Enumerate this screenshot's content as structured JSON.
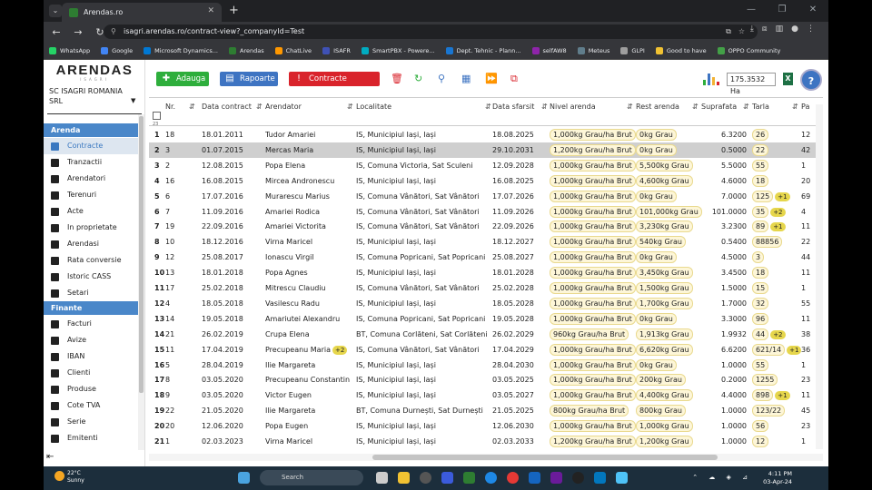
{
  "browser": {
    "tab_title": "Arendas.ro",
    "url": "isagri.arendas.ro/contract-view?_companyId=Test",
    "bookmarks": [
      "WhatsApp",
      "Google",
      "Microsoft Dynamics...",
      "Arendas",
      "ChatLive",
      "ISAFR",
      "SmartPBX - Powere...",
      "Dept. Tehnic - Plann...",
      "selfAW8",
      "Meteus",
      "GLPI",
      "Good to have",
      "OPPO Community"
    ]
  },
  "sidebar": {
    "logo": "ARENDAS",
    "logo_sub": "ISAGRI",
    "company": "SC ISAGRI ROMANIA SRL",
    "sections": [
      {
        "title": "Arenda",
        "items": [
          "Contracte",
          "Tranzactii",
          "Arendatori",
          "Terenuri",
          "Acte",
          "In proprietate",
          "Arendasi",
          "Rata conversie",
          "Istoric CASS",
          "Setari"
        ]
      },
      {
        "title": "Finante",
        "items": [
          "Facturi",
          "Avize",
          "IBAN",
          "Clienti",
          "Produse",
          "Cote TVA",
          "Serie",
          "Emitenti"
        ]
      }
    ],
    "active_item": "Contracte"
  },
  "toolbar": {
    "add_label": "Adauga",
    "reports_label": "Rapoarte",
    "expired_label": "Contracte expirate",
    "surface_total": "175.3532 Ha"
  },
  "table": {
    "row_count_label": "23",
    "columns": [
      "Nr.",
      "Data contract",
      "Arendator",
      "Localitate",
      "Data sfarsit",
      "Nivel arenda",
      "Rest arenda",
      "Suprafata",
      "Tarla",
      "Pa"
    ],
    "rows": [
      {
        "idx": "1",
        "nr": "18",
        "date": "18.01.2011",
        "arendator": "Tudor Amariei",
        "arendator_badge": "",
        "loc": "IS, Municipiul Iași, Iași",
        "end": "18.08.2025",
        "nivel": "1,000kg Grau/ha Brut",
        "rest": "0kg Grau",
        "supr": "6.3200",
        "tarla": "26",
        "tarla_badge": "",
        "pa": "12"
      },
      {
        "idx": "2",
        "nr": "3",
        "date": "01.07.2015",
        "arendator": "Mercas Maria",
        "arendator_badge": "",
        "loc": "IS, Municipiul Iași, Iași",
        "end": "29.10.2031",
        "nivel": "1,200kg Grau/ha Brut",
        "rest": "0kg Grau",
        "supr": "0.5000",
        "tarla": "22",
        "tarla_badge": "",
        "pa": "42"
      },
      {
        "idx": "3",
        "nr": "2",
        "date": "12.08.2015",
        "arendator": "Popa Elena",
        "arendator_badge": "",
        "loc": "IS, Comuna Victoria, Sat Sculeni",
        "end": "12.09.2028",
        "nivel": "1,000kg Grau/ha Brut",
        "rest": "5,500kg Grau",
        "supr": "5.5000",
        "tarla": "55",
        "tarla_badge": "",
        "pa": "1"
      },
      {
        "idx": "4",
        "nr": "16",
        "date": "16.08.2015",
        "arendator": "Mircea Andronescu",
        "arendator_badge": "",
        "loc": "IS, Municipiul Iași, Iași",
        "end": "16.08.2025",
        "nivel": "1,000kg Grau/ha Brut",
        "rest": "4,600kg Grau",
        "supr": "4.6000",
        "tarla": "18",
        "tarla_badge": "",
        "pa": "20"
      },
      {
        "idx": "5",
        "nr": "6",
        "date": "17.07.2016",
        "arendator": "Murarescu Marius",
        "arendator_badge": "",
        "loc": "IS, Comuna Vânători, Sat Vânători",
        "end": "17.07.2026",
        "nivel": "1,000kg Grau/ha Brut",
        "rest": "0kg Grau",
        "supr": "7.0000",
        "tarla": "125",
        "tarla_badge": "+1",
        "pa": "69"
      },
      {
        "idx": "6",
        "nr": "7",
        "date": "11.09.2016",
        "arendator": "Amariei Rodica",
        "arendator_badge": "",
        "loc": "IS, Comuna Vânători, Sat Vânători",
        "end": "11.09.2026",
        "nivel": "1,000kg Grau/ha Brut",
        "rest": "101,000kg Grau",
        "supr": "101.0000",
        "tarla": "35",
        "tarla_badge": "+2",
        "pa": "4"
      },
      {
        "idx": "7",
        "nr": "19",
        "date": "22.09.2016",
        "arendator": "Amariei Victorita",
        "arendator_badge": "",
        "loc": "IS, Comuna Vânători, Sat Vânători",
        "end": "22.09.2026",
        "nivel": "1,000kg Grau/ha Brut",
        "rest": "3,230kg Grau",
        "supr": "3.2300",
        "tarla": "89",
        "tarla_badge": "+1",
        "pa": "11"
      },
      {
        "idx": "8",
        "nr": "10",
        "date": "18.12.2016",
        "arendator": "Virna Maricel",
        "arendator_badge": "",
        "loc": "IS, Municipiul Iași, Iași",
        "end": "18.12.2027",
        "nivel": "1,000kg Grau/ha Brut",
        "rest": "540kg Grau",
        "supr": "0.5400",
        "tarla": "88856",
        "tarla_badge": "",
        "pa": "22"
      },
      {
        "idx": "9",
        "nr": "12",
        "date": "25.08.2017",
        "arendator": "Ionascu Virgil",
        "arendator_badge": "",
        "loc": "IS, Comuna Popricani, Sat Popricani",
        "end": "25.08.2027",
        "nivel": "1,000kg Grau/ha Brut",
        "rest": "0kg Grau",
        "supr": "4.5000",
        "tarla": "3",
        "tarla_badge": "",
        "pa": "44"
      },
      {
        "idx": "10",
        "nr": "13",
        "date": "18.01.2018",
        "arendator": "Popa Agnes",
        "arendator_badge": "",
        "loc": "IS, Municipiul Iași, Iași",
        "end": "18.01.2028",
        "nivel": "1,000kg Grau/ha Brut",
        "rest": "3,450kg Grau",
        "supr": "3.4500",
        "tarla": "18",
        "tarla_badge": "",
        "pa": "11"
      },
      {
        "idx": "11",
        "nr": "17",
        "date": "25.02.2018",
        "arendator": "Mitrescu Claudiu",
        "arendator_badge": "",
        "loc": "IS, Comuna Vânători, Sat Vânători",
        "end": "25.02.2028",
        "nivel": "1,000kg Grau/ha Brut",
        "rest": "1,500kg Grau",
        "supr": "1.5000",
        "tarla": "15",
        "tarla_badge": "",
        "pa": "1"
      },
      {
        "idx": "12",
        "nr": "4",
        "date": "18.05.2018",
        "arendator": "Vasilescu Radu",
        "arendator_badge": "",
        "loc": "IS, Municipiul Iași, Iași",
        "end": "18.05.2028",
        "nivel": "1,000kg Grau/ha Brut",
        "rest": "1,700kg Grau",
        "supr": "1.7000",
        "tarla": "32",
        "tarla_badge": "",
        "pa": "55"
      },
      {
        "idx": "13",
        "nr": "14",
        "date": "19.05.2018",
        "arendator": "Amariutei Alexandru",
        "arendator_badge": "",
        "loc": "IS, Comuna Popricani, Sat Popricani",
        "end": "19.05.2028",
        "nivel": "1,000kg Grau/ha Brut",
        "rest": "0kg Grau",
        "supr": "3.3000",
        "tarla": "96",
        "tarla_badge": "",
        "pa": "11"
      },
      {
        "idx": "14",
        "nr": "21",
        "date": "26.02.2019",
        "arendator": "Crupa Elena",
        "arendator_badge": "",
        "loc": "BT, Comuna Corlăteni, Sat Corlăteni",
        "end": "26.02.2029",
        "nivel": "960kg Grau/ha Brut",
        "rest": "1,913kg Grau",
        "supr": "1.9932",
        "tarla": "44",
        "tarla_badge": "+2",
        "pa": "38"
      },
      {
        "idx": "15",
        "nr": "11",
        "date": "17.04.2019",
        "arendator": "Precupeanu Maria",
        "arendator_badge": "+2",
        "loc": "IS, Comuna Vânători, Sat Vânători",
        "end": "17.04.2029",
        "nivel": "1,000kg Grau/ha Brut",
        "rest": "6,620kg Grau",
        "supr": "6.6200",
        "tarla": "621/14",
        "tarla_badge": "+1",
        "pa": "36"
      },
      {
        "idx": "16",
        "nr": "5",
        "date": "28.04.2019",
        "arendator": "Ilie Margareta",
        "arendator_badge": "",
        "loc": "IS, Municipiul Iași, Iași",
        "end": "28.04.2030",
        "nivel": "1,000kg Grau/ha Brut",
        "rest": "0kg Grau",
        "supr": "1.0000",
        "tarla": "55",
        "tarla_badge": "",
        "pa": "1"
      },
      {
        "idx": "17",
        "nr": "8",
        "date": "03.05.2020",
        "arendator": "Precupeanu Constantin",
        "arendator_badge": "",
        "loc": "IS, Municipiul Iași, Iași",
        "end": "03.05.2025",
        "nivel": "1,000kg Grau/ha Brut",
        "rest": "200kg Grau",
        "supr": "0.2000",
        "tarla": "1255",
        "tarla_badge": "",
        "pa": "23"
      },
      {
        "idx": "18",
        "nr": "9",
        "date": "03.05.2020",
        "arendator": "Victor Eugen",
        "arendator_badge": "",
        "loc": "IS, Municipiul Iași, Iași",
        "end": "03.05.2027",
        "nivel": "1,000kg Grau/ha Brut",
        "rest": "4,400kg Grau",
        "supr": "4.4000",
        "tarla": "898",
        "tarla_badge": "+1",
        "pa": "11"
      },
      {
        "idx": "19",
        "nr": "22",
        "date": "21.05.2020",
        "arendator": "Ilie Margareta",
        "arendator_badge": "",
        "loc": "BT, Comuna Durnești, Sat Durnești",
        "end": "21.05.2025",
        "nivel": "800kg Grau/ha Brut",
        "rest": "800kg Grau",
        "supr": "1.0000",
        "tarla": "123/22",
        "tarla_badge": "",
        "pa": "45"
      },
      {
        "idx": "20",
        "nr": "20",
        "date": "12.06.2020",
        "arendator": "Popa Eugen",
        "arendator_badge": "",
        "loc": "IS, Municipiul Iași, Iași",
        "end": "12.06.2030",
        "nivel": "1,000kg Grau/ha Brut",
        "rest": "1,000kg Grau",
        "supr": "1.0000",
        "tarla": "56",
        "tarla_badge": "",
        "pa": "23"
      },
      {
        "idx": "21",
        "nr": "1",
        "date": "02.03.2023",
        "arendator": "Virna Maricel",
        "arendator_badge": "",
        "loc": "IS, Municipiul Iași, Iași",
        "end": "02.03.2033",
        "nivel": "1,200kg Grau/ha Brut",
        "rest": "1,200kg Grau",
        "supr": "1.0000",
        "tarla": "12",
        "tarla_badge": "",
        "pa": "1"
      }
    ]
  },
  "taskbar": {
    "temp": "22°C",
    "weather": "Sunny",
    "search": "Search",
    "time": "4:11 PM",
    "date": "03-Apr-24"
  },
  "colors": {
    "green": "#2eae3c",
    "blue": "#3e74c2",
    "red": "#d9232b",
    "section": "#4a87c9"
  }
}
